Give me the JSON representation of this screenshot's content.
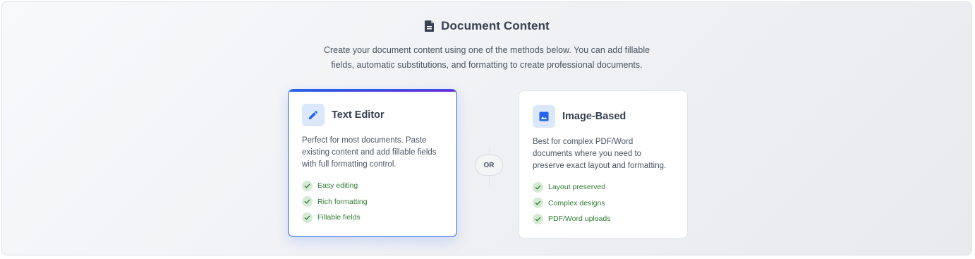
{
  "section": {
    "icon": "document-icon",
    "title": "Document Content",
    "subtitle": "Create your document content using one of the methods below. You can add fillable fields, automatic substitutions, and formatting to create professional documents."
  },
  "divider": {
    "label": "OR"
  },
  "options": [
    {
      "icon": "pencil-icon",
      "title": "Text Editor",
      "selected": true,
      "description": "Perfect for most documents. Paste existing content and add fillable fields with full formatting control.",
      "features": [
        "Easy editing",
        "Rich formatting",
        "Fillable fields"
      ]
    },
    {
      "icon": "image-icon",
      "title": "Image-Based",
      "selected": false,
      "description": "Best for complex PDF/Word documents where you need to preserve exact layout and formatting.",
      "features": [
        "Layout preserved",
        "Complex designs",
        "PDF/Word uploads"
      ]
    }
  ],
  "colors": {
    "accent": "#2563eb",
    "accent_gradient_end": "#6d28d9",
    "feature_green": "#2f7d32",
    "check_bg": "#d5ead7",
    "icon_bg": "#dbe7fb"
  }
}
